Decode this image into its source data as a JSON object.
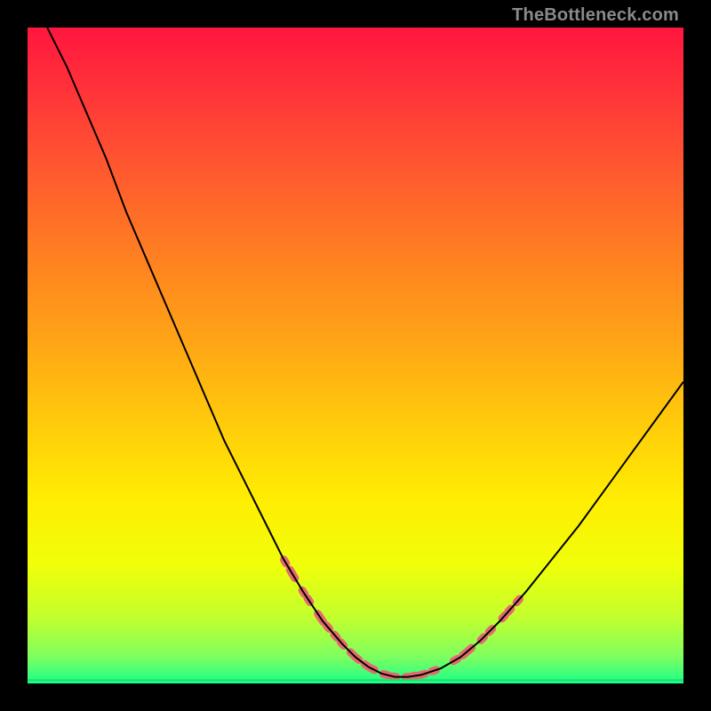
{
  "attribution": "TheBottleneck.com",
  "chart_data": {
    "type": "line",
    "title": "",
    "xlabel": "",
    "ylabel": "",
    "xlim": [
      0,
      100
    ],
    "ylim": [
      0,
      100
    ],
    "series": [
      {
        "name": "curve",
        "x": [
          3,
          6,
          9,
          12,
          15,
          18,
          21,
          24,
          27,
          30,
          33,
          36,
          39,
          42,
          45,
          48,
          50,
          52,
          54,
          56,
          58,
          60,
          63,
          66,
          69,
          72,
          76,
          80,
          84,
          88,
          92,
          96,
          100
        ],
        "y": [
          100,
          94,
          87,
          80,
          72,
          65,
          58,
          51,
          44,
          37,
          31,
          25,
          19,
          14,
          9.5,
          6,
          4,
          2.5,
          1.5,
          1,
          1,
          1.3,
          2.3,
          4,
          6.5,
          9.5,
          14,
          19,
          24,
          29.5,
          35,
          40.5,
          46
        ]
      },
      {
        "name": "flat-line",
        "x": [
          0,
          100
        ],
        "y": [
          0.5,
          0.5
        ]
      }
    ],
    "dot_clusters": [
      {
        "side": "left",
        "approx_x_range": [
          39,
          49
        ],
        "approx_y_range": [
          2,
          19
        ],
        "count": 11
      },
      {
        "side": "bottom",
        "approx_x_range": [
          50,
          62
        ],
        "approx_y_range": [
          1,
          2.5
        ],
        "count": 9
      },
      {
        "side": "right",
        "approx_x_range": [
          65,
          75
        ],
        "approx_y_range": [
          3,
          13
        ],
        "count": 8
      }
    ],
    "gradient_stops": [
      {
        "offset": 0.0,
        "color": "#ff163f"
      },
      {
        "offset": 0.1,
        "color": "#ff3439"
      },
      {
        "offset": 0.22,
        "color": "#ff5a2f"
      },
      {
        "offset": 0.35,
        "color": "#ff8021"
      },
      {
        "offset": 0.48,
        "color": "#ffa516"
      },
      {
        "offset": 0.6,
        "color": "#ffca0b"
      },
      {
        "offset": 0.72,
        "color": "#ffed02"
      },
      {
        "offset": 0.82,
        "color": "#f0ff09"
      },
      {
        "offset": 0.9,
        "color": "#c2ff2e"
      },
      {
        "offset": 0.96,
        "color": "#7dff60"
      },
      {
        "offset": 1.0,
        "color": "#1aff8a"
      }
    ],
    "dot_color": "#e46a6f",
    "curve_color": "#000000"
  }
}
